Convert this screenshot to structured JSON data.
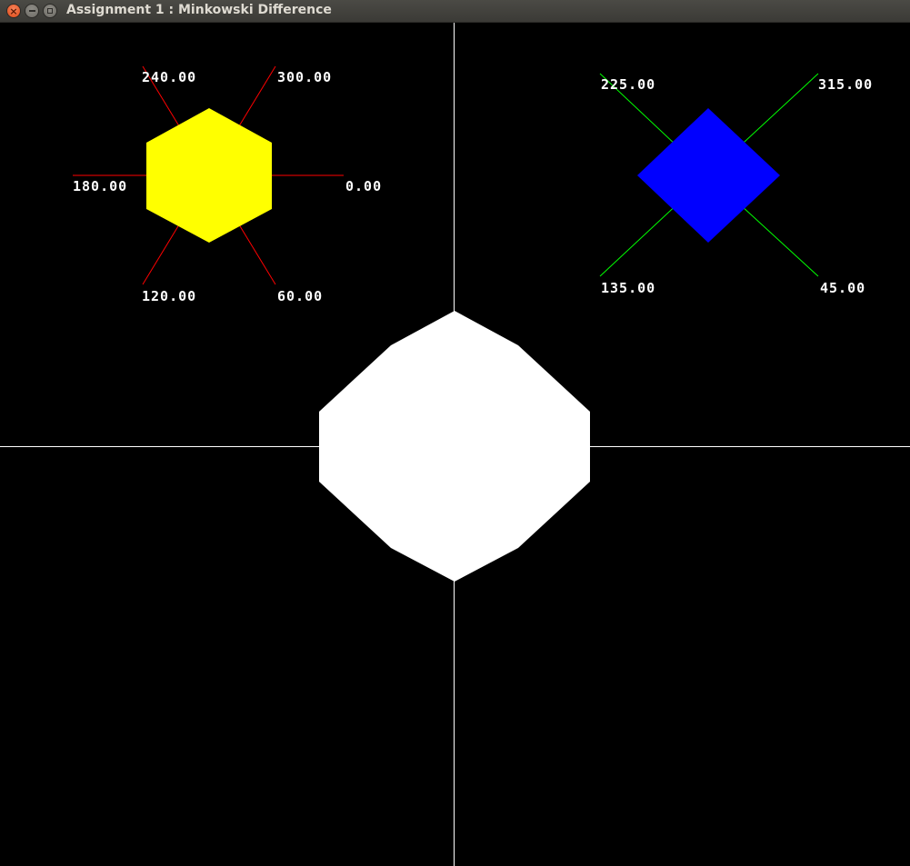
{
  "window": {
    "title": "Assignment 1 : Minkowski Difference",
    "buttons": {
      "close": "close-icon",
      "minimize": "minimize-icon",
      "maximize": "maximize-icon"
    }
  },
  "colors": {
    "background": "#000000",
    "axes": "#ffffff",
    "polygon_a": "#ffff00",
    "polygon_a_normals": "#ff0000",
    "polygon_b": "#0000ff",
    "polygon_b_normals": "#00ff00",
    "minkowski_difference": "#ffffff"
  },
  "hexagon": {
    "normal_labels": {
      "n240": "240.00",
      "n300": "300.00",
      "n180": "180.00",
      "n0": "0.00",
      "n120": "120.00",
      "n60": "60.00"
    }
  },
  "diamond": {
    "normal_labels": {
      "n225": "225.00",
      "n315": "315.00",
      "n135": "135.00",
      "n45": "45.00"
    }
  }
}
